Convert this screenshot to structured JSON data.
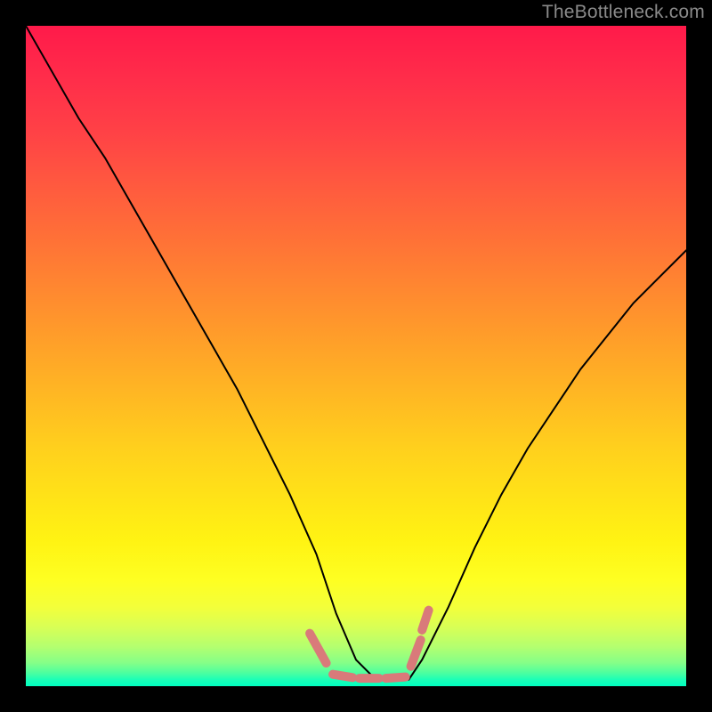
{
  "watermark": "TheBottleneck.com",
  "chart_data": {
    "type": "line",
    "title": "",
    "xlabel": "",
    "ylabel": "",
    "xlim": [
      0,
      100
    ],
    "ylim": [
      0,
      100
    ],
    "grid": false,
    "legend": false,
    "annotations": [],
    "series": [
      {
        "name": "bottleneck-curve",
        "stroke": "#000000",
        "x": [
          0,
          4,
          8,
          12,
          16,
          20,
          24,
          28,
          32,
          36,
          40,
          44,
          47,
          50,
          53,
          56,
          58,
          60,
          64,
          68,
          72,
          76,
          80,
          84,
          88,
          92,
          96,
          100
        ],
        "y": [
          100,
          93,
          86,
          80,
          73,
          66,
          59,
          52,
          45,
          37,
          29,
          20,
          11,
          4,
          1,
          1,
          1,
          4,
          12,
          21,
          29,
          36,
          42,
          48,
          53,
          58,
          62,
          66
        ]
      },
      {
        "name": "bottom-marker-dashes",
        "stroke": "#d97a7a",
        "segments": [
          {
            "x": [
              43.0,
              45.5
            ],
            "y": [
              8.0,
              3.5
            ]
          },
          {
            "x": [
              46.5,
              49.5
            ],
            "y": [
              1.8,
              1.3
            ]
          },
          {
            "x": [
              50.5,
              53.5
            ],
            "y": [
              1.2,
              1.2
            ]
          },
          {
            "x": [
              54.5,
              57.5
            ],
            "y": [
              1.2,
              1.4
            ]
          },
          {
            "x": [
              58.3,
              59.8
            ],
            "y": [
              3.0,
              7.0
            ]
          },
          {
            "x": [
              60.0,
              61.0
            ],
            "y": [
              8.5,
              11.5
            ]
          }
        ]
      }
    ]
  },
  "colors": {
    "frame": "#000000",
    "curve": "#000000",
    "marker": "#d97a7a",
    "watermark": "#8a8a8a"
  }
}
